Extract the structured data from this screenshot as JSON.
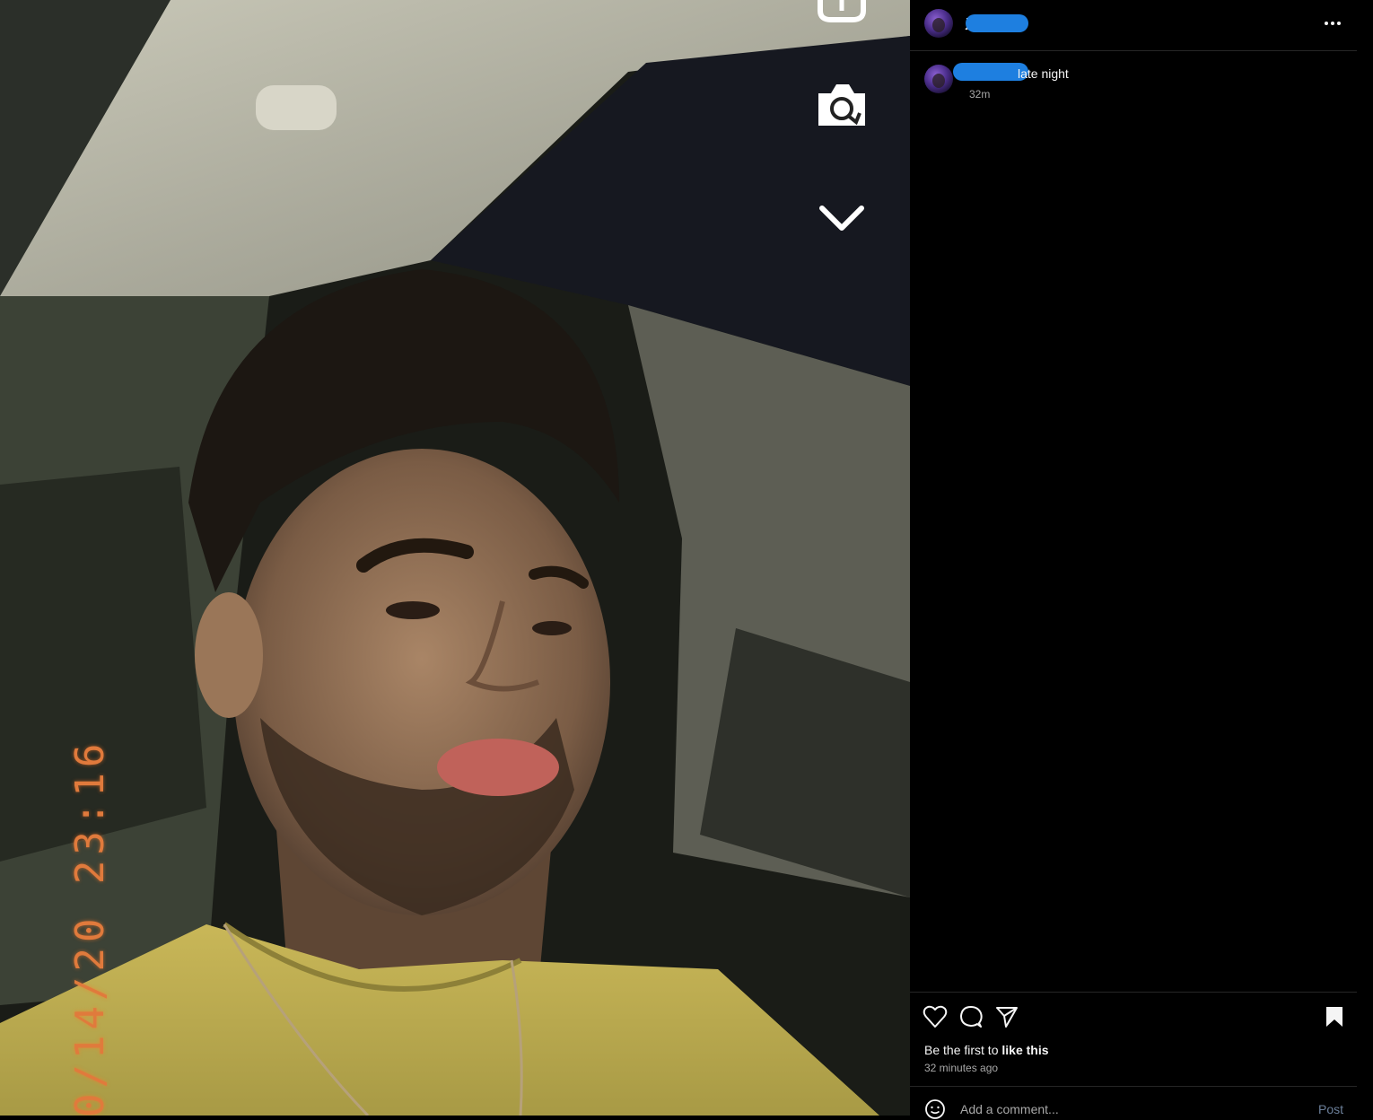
{
  "photo": {
    "timestamp_text": "0/14/20  23:16",
    "icons": [
      "boomerang-icon",
      "camera-flip-icon",
      "chevron-down-icon"
    ]
  },
  "post": {
    "header": {
      "username": "j",
      "more_icon": "more-horizontal-icon"
    },
    "caption": {
      "text": "late night",
      "time": "32m"
    },
    "actions": {
      "like_icon": "heart-icon",
      "comment_icon": "comment-icon",
      "share_icon": "send-icon",
      "save_icon": "bookmark-icon"
    },
    "likes": {
      "prefix": "Be the first to",
      "bold": "like this"
    },
    "posted_ago": "32 minutes ago",
    "comment": {
      "placeholder": "Add a comment...",
      "post_label": "Post",
      "emoji_icon": "emoji-icon"
    }
  },
  "colors": {
    "panel_bg": "#000000",
    "border": "#262626",
    "muted": "#a8a8a8",
    "post_btn": "#6b7f99",
    "timestamp": "#e07a3c"
  }
}
